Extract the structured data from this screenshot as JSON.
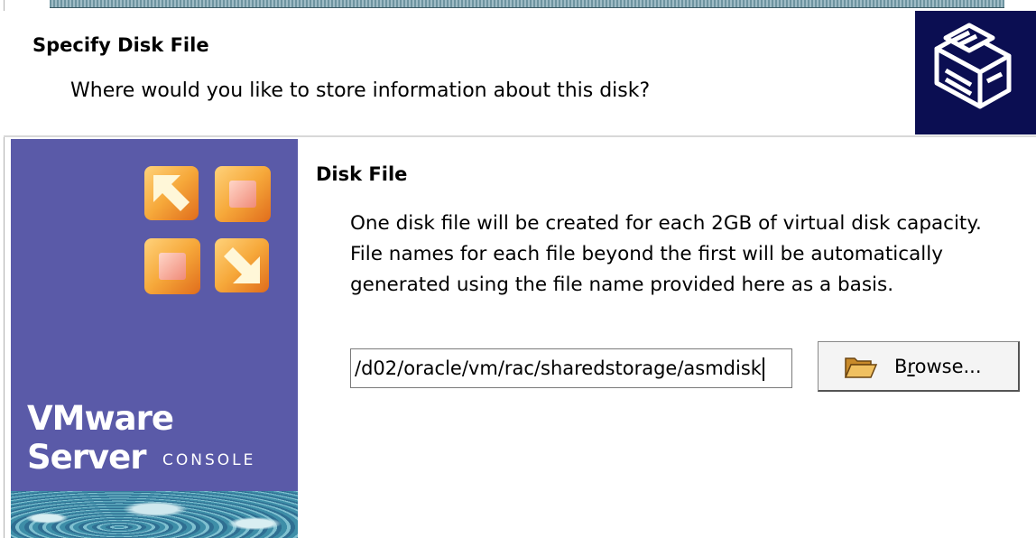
{
  "header": {
    "title": "Specify Disk File",
    "subtitle": "Where would you like to store information about this disk?",
    "icon": "disk-drive-icon",
    "icon_bg": "#0b0e52"
  },
  "sidebar": {
    "brand": "VMware Server",
    "brand_sub": "CONSOLE",
    "logo": "vmware-logo-icon",
    "bg_color": "#5a5aa8",
    "logo_color": "#f5a020"
  },
  "content": {
    "section_title": "Disk File",
    "description": "One disk file will be created for each 2GB of virtual disk capacity. File names for each file beyond the first will be automatically generated using the file name provided here as a basis.",
    "file_path": "/d02/oracle/vm/rac/sharedstorage/asmdisk",
    "browse_button": {
      "label_pre": "B",
      "label_underlined": "r",
      "label_post": "owse...",
      "icon": "folder-open-icon"
    }
  }
}
